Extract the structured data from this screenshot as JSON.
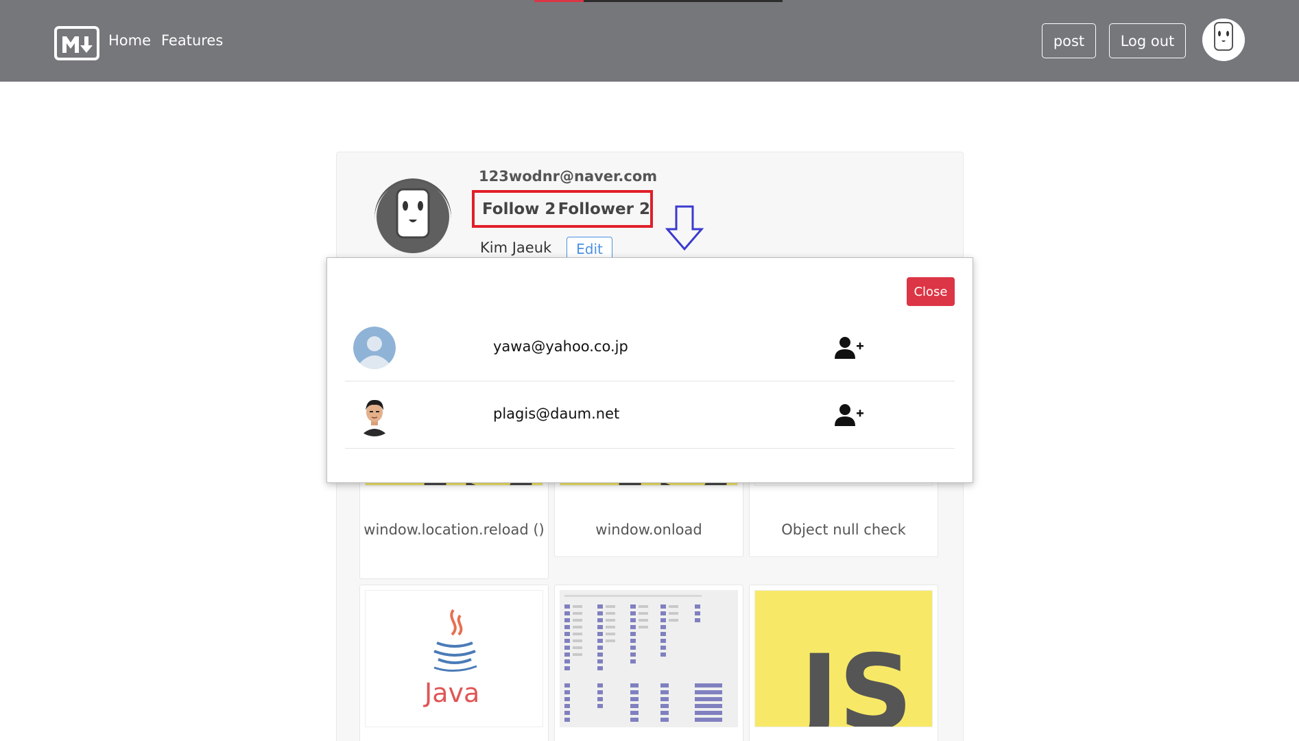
{
  "header": {
    "logo_icon": "markdown-logo-icon",
    "nav": [
      {
        "label": "Home"
      },
      {
        "label": "Features"
      }
    ],
    "post_button": "post",
    "logout_button": "Log out",
    "avatar_icon": "marshmallow-avatar-icon"
  },
  "profile": {
    "email": "123wodnr@naver.com",
    "follow_label": "Follow 2",
    "follower_label": "Follower 2",
    "name": "Kim Jaeuk",
    "edit_button": "Edit",
    "highlight_color": "#e01f2a",
    "arrow_icon": "down-arrow-icon"
  },
  "posts": [
    {
      "title": "window.location.reload ()",
      "thumb": "js-logo"
    },
    {
      "title": "window.onload",
      "thumb": "js-logo"
    },
    {
      "title": "Object null check",
      "thumb": "blank"
    },
    {
      "title": "",
      "thumb": "java-logo"
    },
    {
      "title": "",
      "thumb": "keycode-table"
    },
    {
      "title": "",
      "thumb": "js-logo"
    }
  ],
  "thumb_labels": {
    "java": "Java",
    "js": "JS"
  },
  "modal": {
    "close_button": "Close",
    "users": [
      {
        "email": "yawa@yahoo.co.jp",
        "avatar": "default-avatar-icon",
        "action_icon": "add-user-icon"
      },
      {
        "email": "plagis@daum.net",
        "avatar": "portrait-avatar",
        "action_icon": "add-user-icon"
      }
    ]
  },
  "colors": {
    "navbar": "#76777b",
    "close": "#dc3545",
    "edit": "#4a90e2",
    "js_yellow": "#f7e967"
  }
}
